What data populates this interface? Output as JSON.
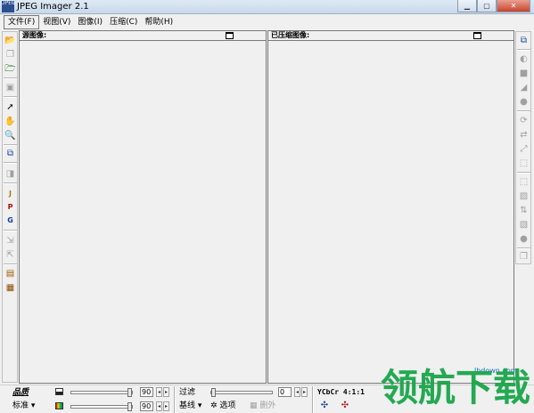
{
  "window": {
    "title": "JPEG Imager 2.1",
    "icon_text": "JPEG"
  },
  "menu": [
    {
      "label": "文件(F)"
    },
    {
      "label": "视图(V)"
    },
    {
      "label": "图像(I)"
    },
    {
      "label": "压缩(C)"
    },
    {
      "label": "帮助(H)"
    }
  ],
  "panes": {
    "source_title": "源图像:",
    "compressed_title": "已压缩图像:"
  },
  "status": {
    "quality_label": "品质",
    "standard_label": "标准",
    "quality_value": "90",
    "color_value": "90",
    "filter_label": "过滤",
    "filter_value": "0",
    "baseline_label": "基线",
    "options_label": "选项",
    "delete_label": "删外",
    "ycbcr_label": "YCbCr 4:1:1"
  },
  "watermark": {
    "site": "lhdown.com",
    "text": "领航下载"
  },
  "colors": {
    "title_gradient_top": "#dfe9f5",
    "close_button": "#c8442c",
    "watermark": "#1aa64a",
    "watermark_site": "#1b6fc2"
  }
}
